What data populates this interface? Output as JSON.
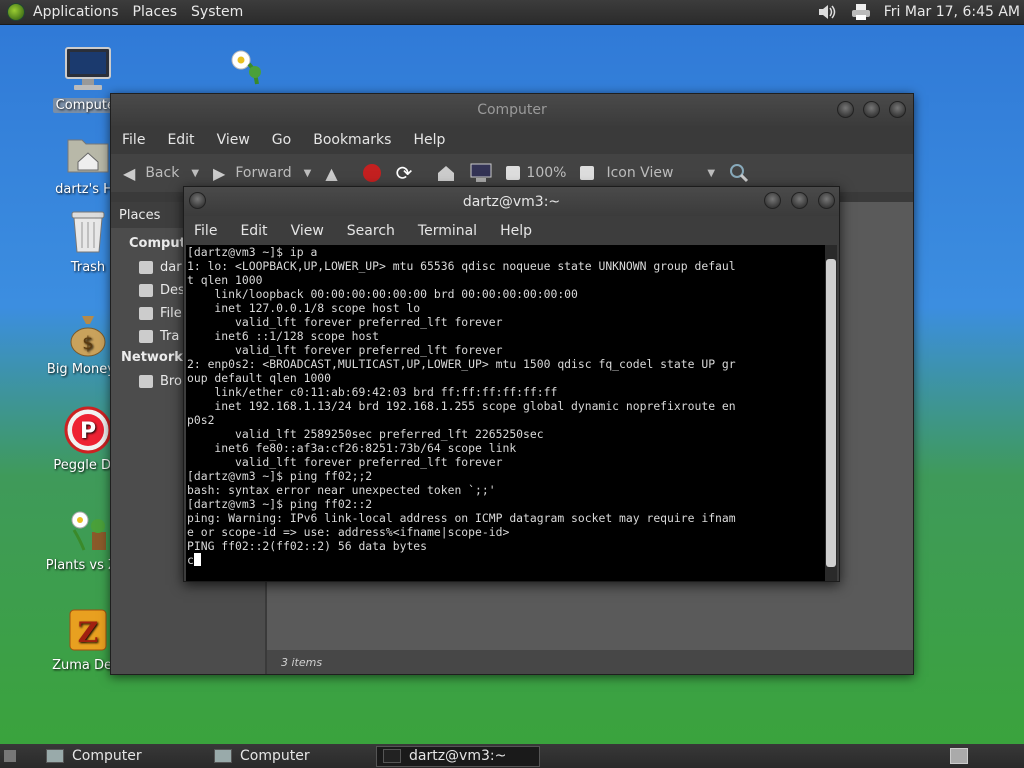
{
  "top_panel": {
    "menus": [
      "Applications",
      "Places",
      "System"
    ],
    "clock": "Fri Mar 17,  6:45 AM"
  },
  "desktop_icons": [
    {
      "label": "Computer",
      "icon": "computer-icon"
    },
    {
      "label": "dartz's Ho",
      "icon": "home-folder-icon"
    },
    {
      "label": "Trash",
      "icon": "trash-icon"
    },
    {
      "label": "Big Money D",
      "icon": "money-bag-icon"
    },
    {
      "label": "Peggle Del",
      "icon": "peggle-icon"
    },
    {
      "label": "Plants vs Zor",
      "icon": "plants-icon"
    },
    {
      "label": "Zuma Delu",
      "icon": "zuma-icon"
    }
  ],
  "nautilus": {
    "title": "Computer",
    "menus": [
      "File",
      "Edit",
      "View",
      "Go",
      "Bookmarks",
      "Help"
    ],
    "toolbar": {
      "back": "Back",
      "forward": "Forward",
      "zoom": "100%",
      "view_mode": "Icon View"
    },
    "sidebar": {
      "header": "Places",
      "sections": [
        {
          "label": "Compute",
          "items": [
            "dar",
            "Des",
            "File",
            "Tra"
          ]
        },
        {
          "label": "Network",
          "items": [
            "Bro"
          ]
        }
      ]
    },
    "status": "3 items"
  },
  "terminal": {
    "title": "dartz@vm3:~",
    "menus": [
      "File",
      "Edit",
      "View",
      "Search",
      "Terminal",
      "Help"
    ],
    "lines": [
      "[dartz@vm3 ~]$ ip a",
      "1: lo: <LOOPBACK,UP,LOWER_UP> mtu 65536 qdisc noqueue state UNKNOWN group defaul",
      "t qlen 1000",
      "    link/loopback 00:00:00:00:00:00 brd 00:00:00:00:00:00",
      "    inet 127.0.0.1/8 scope host lo",
      "       valid_lft forever preferred_lft forever",
      "    inet6 ::1/128 scope host",
      "       valid_lft forever preferred_lft forever",
      "2: enp0s2: <BROADCAST,MULTICAST,UP,LOWER_UP> mtu 1500 qdisc fq_codel state UP gr",
      "oup default qlen 1000",
      "    link/ether c0:11:ab:69:42:03 brd ff:ff:ff:ff:ff:ff",
      "    inet 192.168.1.13/24 brd 192.168.1.255 scope global dynamic noprefixroute en",
      "p0s2",
      "       valid_lft 2589250sec preferred_lft 2265250sec",
      "    inet6 fe80::af3a:cf26:8251:73b/64 scope link",
      "       valid_lft forever preferred_lft forever",
      "[dartz@vm3 ~]$ ping ff02;;2",
      "bash: syntax error near unexpected token `;;'",
      "[dartz@vm3 ~]$ ping ff02::2",
      "ping: Warning: IPv6 link-local address on ICMP datagram socket may require ifnam",
      "e or scope-id => use: address%<ifname|scope-id>",
      "PING ff02::2(ff02::2) 56 data bytes",
      "c"
    ]
  },
  "taskbar": {
    "tasks": [
      "Computer",
      "Computer",
      "dartz@vm3:~"
    ]
  }
}
